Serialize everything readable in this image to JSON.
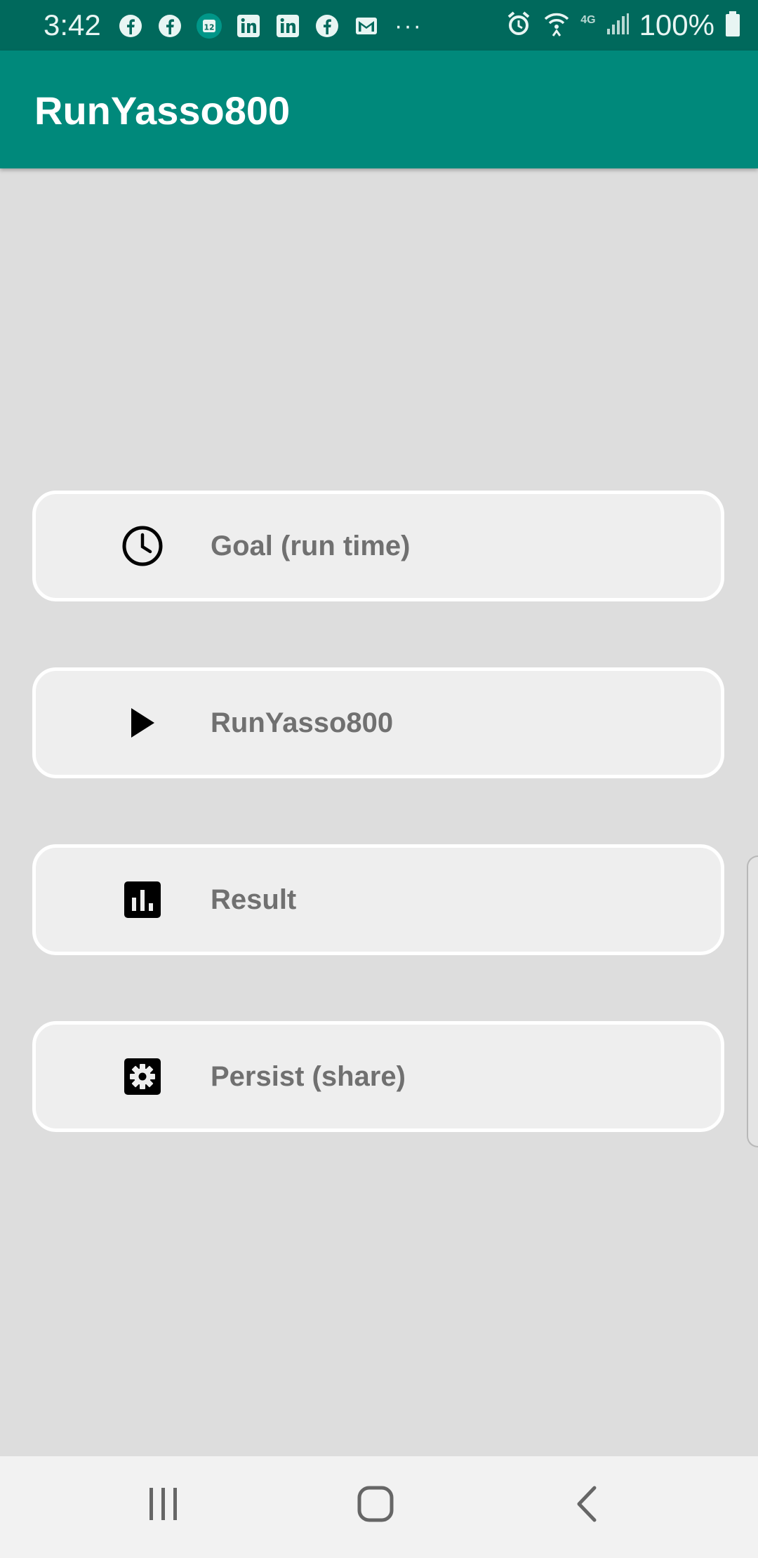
{
  "status_bar": {
    "time": "3:42",
    "notification_icons": [
      "facebook-icon",
      "facebook-icon",
      "calendar-icon",
      "linkedin-icon",
      "linkedin-icon",
      "facebook-icon",
      "gmail-icon"
    ],
    "overflow": "···",
    "network_type": "4G",
    "battery_percent": "100%"
  },
  "app_bar": {
    "title": "RunYasso800",
    "color": "#00897b"
  },
  "menu": {
    "items": [
      {
        "label": "Goal (run time)",
        "icon": "clock-icon"
      },
      {
        "label": "RunYasso800",
        "icon": "play-icon"
      },
      {
        "label": "Result",
        "icon": "bar-chart-icon"
      },
      {
        "label": "Persist (share)",
        "icon": "settings-icon"
      }
    ]
  },
  "nav_bar": {
    "buttons": [
      "recent-apps-icon",
      "home-icon",
      "back-icon"
    ]
  },
  "colors": {
    "status_bar": "#00695c",
    "background": "#dddddd",
    "button_fill": "#eeeeee",
    "button_border": "#ffffff",
    "button_text": "#707070"
  }
}
